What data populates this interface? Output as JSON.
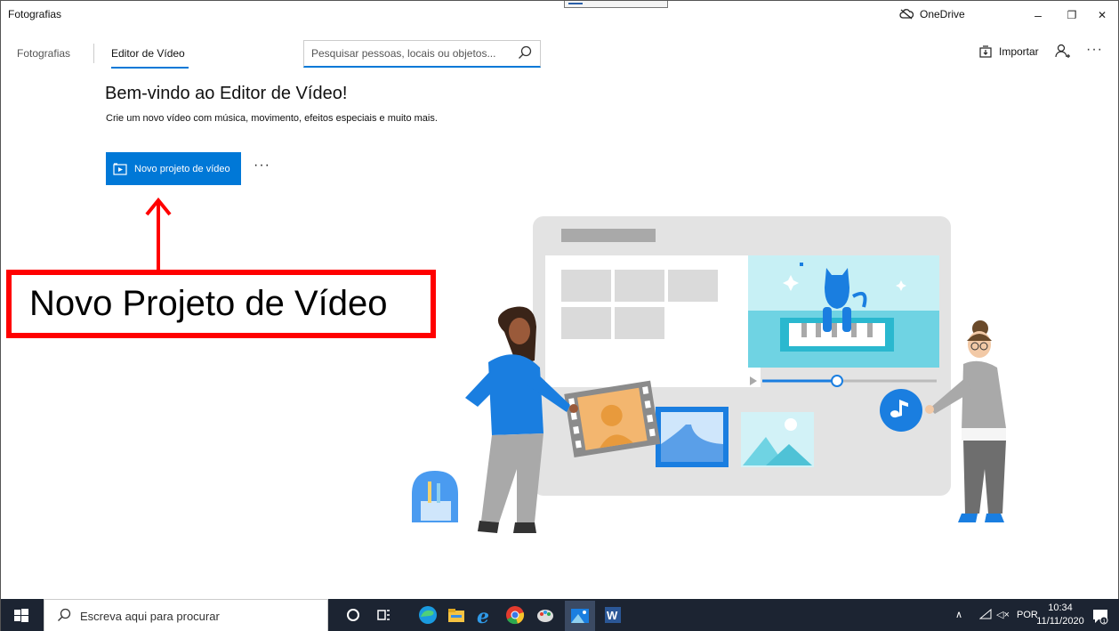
{
  "window": {
    "title": "Fotografias",
    "onedrive_label": "OneDrive",
    "minimize": "–",
    "restore": "❐",
    "close": "✕"
  },
  "nav": {
    "tab_photos": "Fotografias",
    "tab_video_editor": "Editor de Vídeo",
    "search_placeholder": "Pesquisar pessoas, locais ou objetos...",
    "import_label": "Importar",
    "more": "···"
  },
  "main": {
    "welcome_title": "Bem-vindo ao Editor de Vídeo!",
    "welcome_subtitle": "Crie um novo vídeo com música, movimento, efeitos especiais e muito mais.",
    "new_project_label": "Novo projeto de vídeo",
    "more": "···"
  },
  "annotation": {
    "callout_text": "Novo Projeto de Vídeo",
    "color": "#ff0000"
  },
  "taskbar": {
    "search_placeholder": "Escreva aqui para procurar",
    "language": "POR",
    "time": "10:34",
    "date": "11/11/2020",
    "notifications_count": "1",
    "apps": [
      "cortana-icon",
      "task-view-icon",
      "edge-icon",
      "file-explorer-icon",
      "internet-explorer-icon",
      "chrome-icon",
      "paint-icon",
      "photos-icon",
      "word-icon"
    ]
  },
  "colors": {
    "accent": "#0078d7",
    "taskbar": "#1c2432"
  }
}
